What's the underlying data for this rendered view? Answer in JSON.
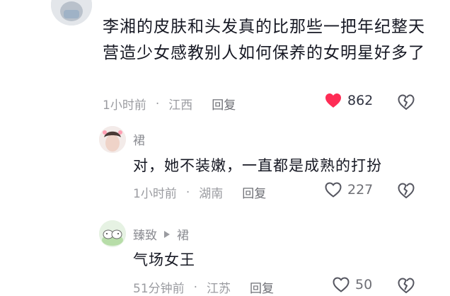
{
  "colors": {
    "liked_heart": "#fe2c55",
    "meta": "#9a9ba0",
    "text": "#161823"
  },
  "comment": {
    "text": "李湘的皮肤和头发真的比那些一把年纪整天营造少女感教别人如何保养的女明星好多了",
    "time": "1小时前",
    "location": "江西",
    "reply_label": "回复",
    "likes": "862",
    "liked": true
  },
  "replies": [
    {
      "author": "裙",
      "text": "对，她不装嫩，一直都是成熟的打扮",
      "time": "1小时前",
      "location": "湖南",
      "reply_label": "回复",
      "likes": "227"
    },
    {
      "author": "臻致",
      "reply_to": "裙",
      "text": "气场女王",
      "time": "51分钟前",
      "location": "江苏",
      "reply_label": "回复",
      "likes": "50"
    }
  ]
}
